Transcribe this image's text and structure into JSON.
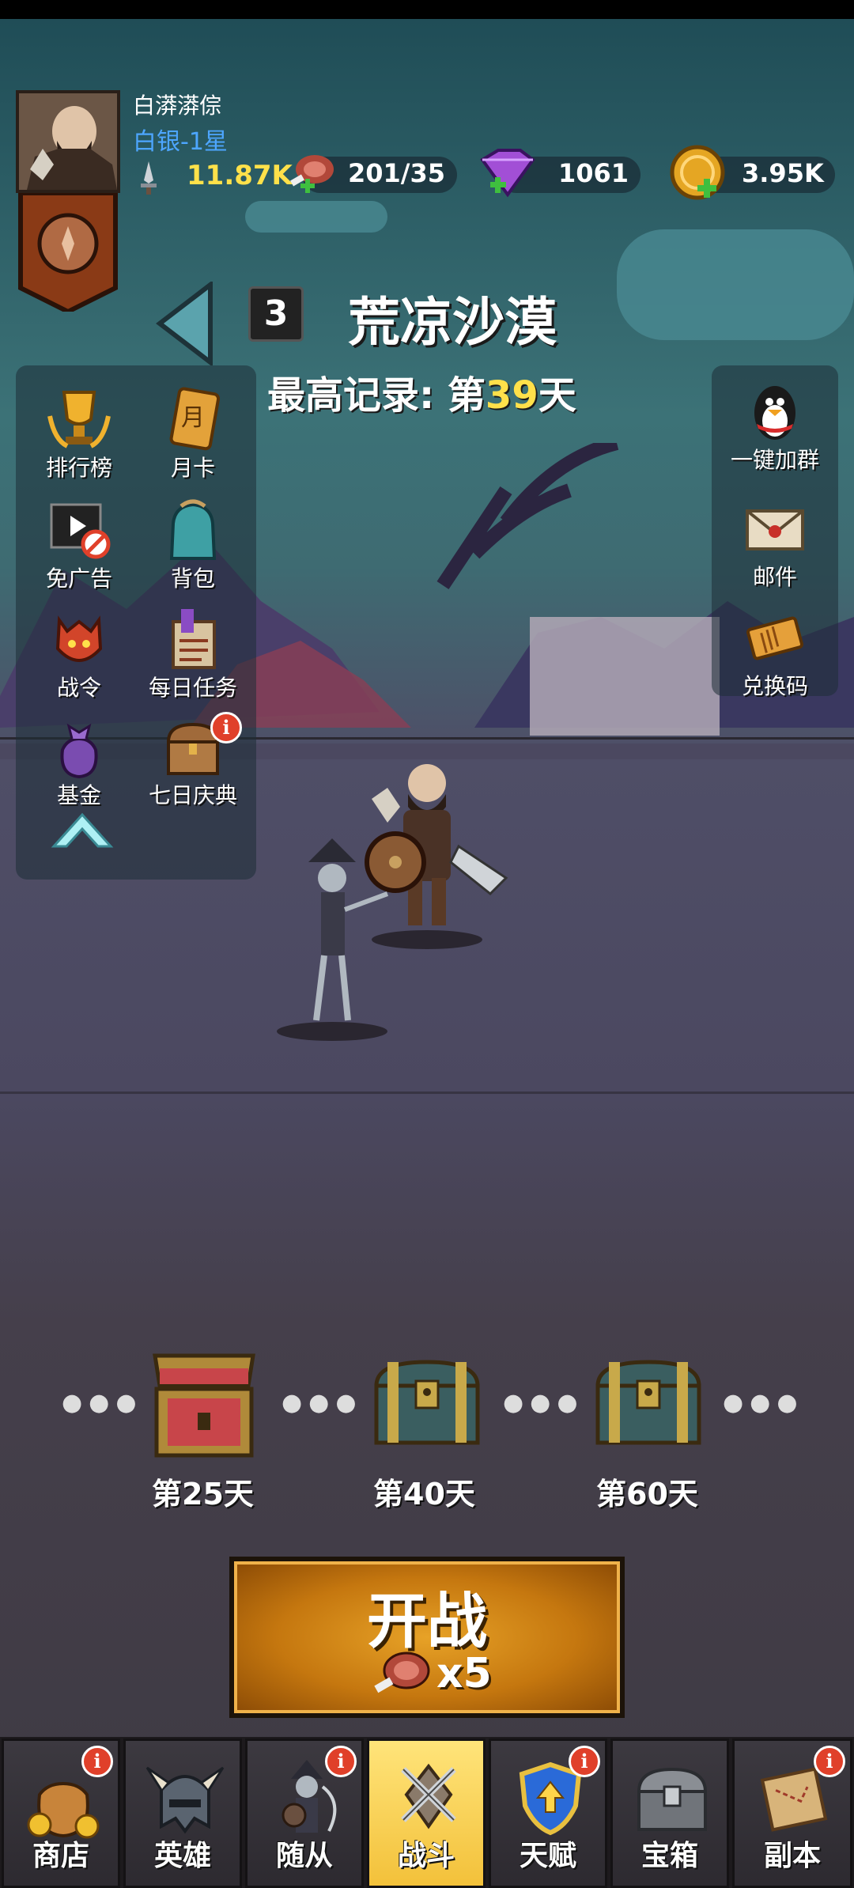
{
  "player": {
    "name": "白漭漭倧",
    "rank": "白银-1星"
  },
  "resources": {
    "power": "11.87K",
    "stamina": "201/35",
    "gems": "1061",
    "gold": "3.95K"
  },
  "stage": {
    "number": "3",
    "name": "荒凉沙漠",
    "best_prefix": "最高记录: 第",
    "best_day": "39",
    "best_suffix": "天"
  },
  "left_menu": [
    {
      "label": "排行榜",
      "icon": "trophy-icon"
    },
    {
      "label": "月卡",
      "icon": "month-card-icon"
    },
    {
      "label": "免广告",
      "icon": "no-ads-icon"
    },
    {
      "label": "背包",
      "icon": "backpack-icon"
    },
    {
      "label": "战令",
      "icon": "battle-pass-icon"
    },
    {
      "label": "每日任务",
      "icon": "daily-task-icon"
    },
    {
      "label": "基金",
      "icon": "fund-icon"
    },
    {
      "label": "七日庆典",
      "icon": "chest-icon"
    }
  ],
  "right_menu": [
    {
      "label": "一键加群",
      "icon": "penguin-icon"
    },
    {
      "label": "邮件",
      "icon": "mail-icon"
    },
    {
      "label": "兑换码",
      "icon": "ticket-icon"
    }
  ],
  "badge_text": "i",
  "milestones": [
    {
      "label": "第25天",
      "state": "opened"
    },
    {
      "label": "第40天",
      "state": "locked"
    },
    {
      "label": "第60天",
      "state": "locked"
    }
  ],
  "battle": {
    "title": "开战",
    "cost": "x5"
  },
  "tabs": [
    {
      "label": "商店",
      "icon": "shop-icon",
      "badge": true
    },
    {
      "label": "英雄",
      "icon": "hero-helmet-icon",
      "badge": false
    },
    {
      "label": "随从",
      "icon": "follower-icon",
      "badge": true
    },
    {
      "label": "战斗",
      "icon": "swords-icon",
      "badge": false
    },
    {
      "label": "天赋",
      "icon": "talent-shield-icon",
      "badge": true
    },
    {
      "label": "宝箱",
      "icon": "treasure-chest-icon",
      "badge": false
    },
    {
      "label": "副本",
      "icon": "scroll-map-icon",
      "badge": true
    }
  ],
  "colors": {
    "accent_yellow": "#ffe14a",
    "rank_blue": "#4da6ff",
    "badge_red": "#e0402a",
    "active_tab": "#f3c13a"
  }
}
